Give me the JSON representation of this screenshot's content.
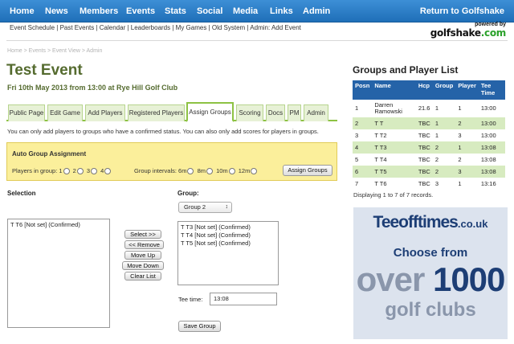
{
  "topnav": {
    "items": [
      "Home",
      "News",
      "Members",
      "Events",
      "Stats",
      "Social",
      "Media",
      "Links",
      "Admin"
    ],
    "return_link": "Return to Golfshake"
  },
  "subnav": "Event Schedule | Past Events | Calendar | Leaderboards | My Games | Old System | Admin: Add Event",
  "logo": {
    "powered_by": "powered by",
    "brand": "golfshake",
    "brand_suffix": ".com"
  },
  "breadcrumb": "Home > Events > Event View > Admin",
  "page": {
    "title": "Test Event",
    "date": "Fri 10th May 2013 from 13:00 at Rye Hill Golf Club"
  },
  "tabs": [
    "Public Page",
    "Edit Game",
    "Add Players",
    "Registered Players",
    "Assign Groups",
    "Scoring",
    "Docs",
    "PM",
    "Admin"
  ],
  "active_tab": "Assign Groups",
  "info_text": "You can only add players to groups who have a confirmed status. You can also only add scores for players in groups.",
  "auto_group": {
    "title": "Auto Group Assignment",
    "players_label": "Players in group:",
    "players_options": [
      "1",
      "2",
      "3",
      "4"
    ],
    "interval_label": "Group intervals:",
    "interval_options": [
      "6m",
      "8m",
      "10m",
      "12m"
    ],
    "button": "Assign Groups"
  },
  "selection": {
    "label": "Selection",
    "items": [
      "T T6 [Not set] (Confirmed)"
    ]
  },
  "buttons": {
    "select": "Select >>",
    "remove": "<< Remove",
    "move_up": "Move Up",
    "move_down": "Move Down",
    "clear": "Clear List",
    "save": "Save Group"
  },
  "group": {
    "label": "Group:",
    "selected": "Group 2",
    "items": [
      "T T3 [Not set] (Confirmed)",
      "T T4 [Not set] (Confirmed)",
      "T T5 [Not set] (Confirmed)"
    ],
    "tee_time_label": "Tee time:",
    "tee_time": "13:08"
  },
  "group_list": {
    "title": "Groups and Player List",
    "headers": [
      "Posn",
      "Name",
      "Hcp",
      "Group",
      "Player",
      "Tee Time"
    ],
    "rows": [
      [
        "1",
        "Darren Ramowski",
        "21.6",
        "1",
        "1",
        "13:00"
      ],
      [
        "2",
        "T T",
        "TBC",
        "1",
        "2",
        "13:00"
      ],
      [
        "3",
        "T T2",
        "TBC",
        "1",
        "3",
        "13:00"
      ],
      [
        "4",
        "T T3",
        "TBC",
        "2",
        "1",
        "13:08"
      ],
      [
        "5",
        "T T4",
        "TBC",
        "2",
        "2",
        "13:08"
      ],
      [
        "6",
        "T T5",
        "TBC",
        "2",
        "3",
        "13:08"
      ],
      [
        "7",
        "T T6",
        "TBC",
        "3",
        "1",
        "13:16"
      ]
    ],
    "records_text": "Displaying 1 to 7 of 7 records."
  },
  "ad": {
    "brand": "Teeofftimes",
    "brand_suffix": ".co.uk",
    "line1": "Choose from",
    "line2_a": "over",
    "line2_b": "1000",
    "line3": "golf clubs"
  }
}
